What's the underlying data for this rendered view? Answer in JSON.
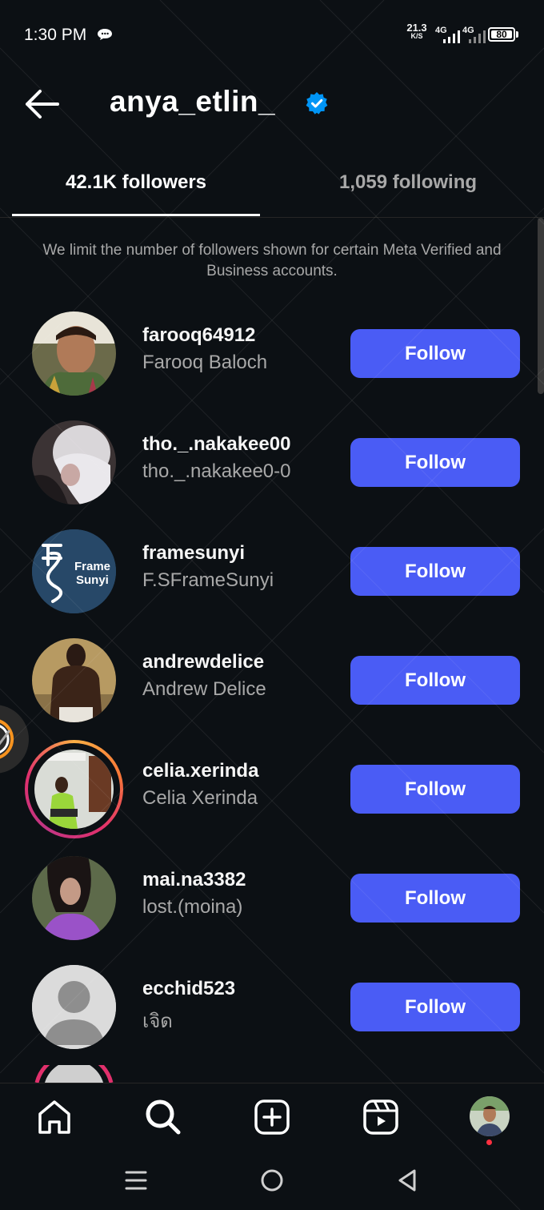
{
  "status_bar": {
    "time": "1:30 PM",
    "net_speed_value": "21.3",
    "net_speed_unit": "K/S",
    "signal1_label": "4G",
    "signal2_label": "4G",
    "battery_level": "80"
  },
  "header": {
    "username": "anya_etlin_",
    "verified": true
  },
  "tabs": [
    {
      "label": "42.1K followers",
      "active": true
    },
    {
      "label": "1,059 following",
      "active": false
    }
  ],
  "notice": "We limit the number of followers shown for certain Meta Verified and Business accounts.",
  "followers": [
    {
      "username": "farooq64912",
      "full_name": "Farooq Baloch",
      "button": "Follow"
    },
    {
      "username": "tho._.nakakee00",
      "full_name": "tho._.nakakee0-0",
      "button": "Follow"
    },
    {
      "username": "framesunyi",
      "full_name": "F.SFrameSunyi",
      "button": "Follow",
      "avatar_text_1": "Frame",
      "avatar_text_2": "Sunyi"
    },
    {
      "username": "andrewdelice",
      "full_name": "Andrew Delice",
      "button": "Follow"
    },
    {
      "username": "celia.xerinda",
      "full_name": "Celia Xerinda",
      "button": "Follow"
    },
    {
      "username": "mai.na3382",
      "full_name": "lost.(moina)",
      "button": "Follow"
    },
    {
      "username": "ecchid523",
      "full_name": "เจิด",
      "button": "Follow"
    }
  ],
  "bottom_nav": [
    "home-icon",
    "search-icon",
    "create-icon",
    "reels-icon",
    "profile-avatar"
  ],
  "colors": {
    "background": "#0c1014",
    "follow_button": "#4a5cf5",
    "verified_badge": "#0095f6",
    "secondary_text": "#a8a8a8"
  }
}
